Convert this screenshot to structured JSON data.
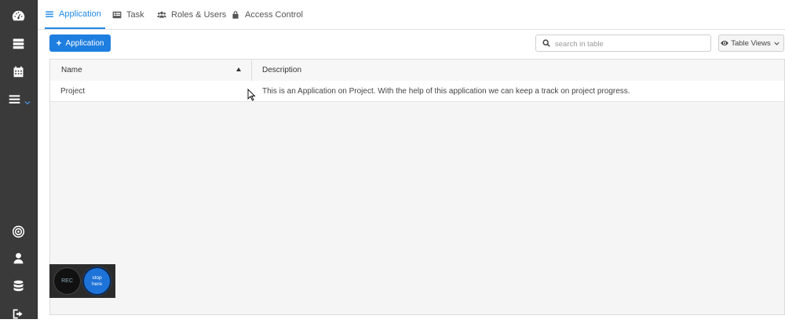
{
  "sidebar": {
    "items": [
      {
        "icon": "dashboard-icon"
      },
      {
        "icon": "server-icon"
      },
      {
        "icon": "calendar-icon"
      },
      {
        "icon": "menu-icon"
      },
      {
        "icon": "target-icon"
      },
      {
        "icon": "user-icon"
      },
      {
        "icon": "database-icon"
      },
      {
        "icon": "sign-out-icon"
      }
    ]
  },
  "tabs": [
    {
      "label": "Application",
      "icon": "list-icon",
      "active": true
    },
    {
      "label": "Task",
      "icon": "task-icon",
      "active": false
    },
    {
      "label": "Roles & Users",
      "icon": "users-icon",
      "active": false
    },
    {
      "label": "Access Control",
      "icon": "lock-icon",
      "active": false
    }
  ],
  "toolbar": {
    "add_label": "Application",
    "search_placeholder": "search in table",
    "table_views_label": "Table Views"
  },
  "table": {
    "columns": [
      "Name",
      "Description"
    ],
    "rows": [
      {
        "name": "Project",
        "description": "This is an Application on Project. With the help of this application we can keep a track on project progress."
      }
    ]
  },
  "recorder": {
    "rec_label": "REC",
    "stop_label_line1": "stop",
    "stop_label_line2": "here"
  },
  "colors": {
    "accent": "#1e88e5",
    "sidebar_bg": "#3a3a3a",
    "primary_button": "#1e7ee0"
  }
}
